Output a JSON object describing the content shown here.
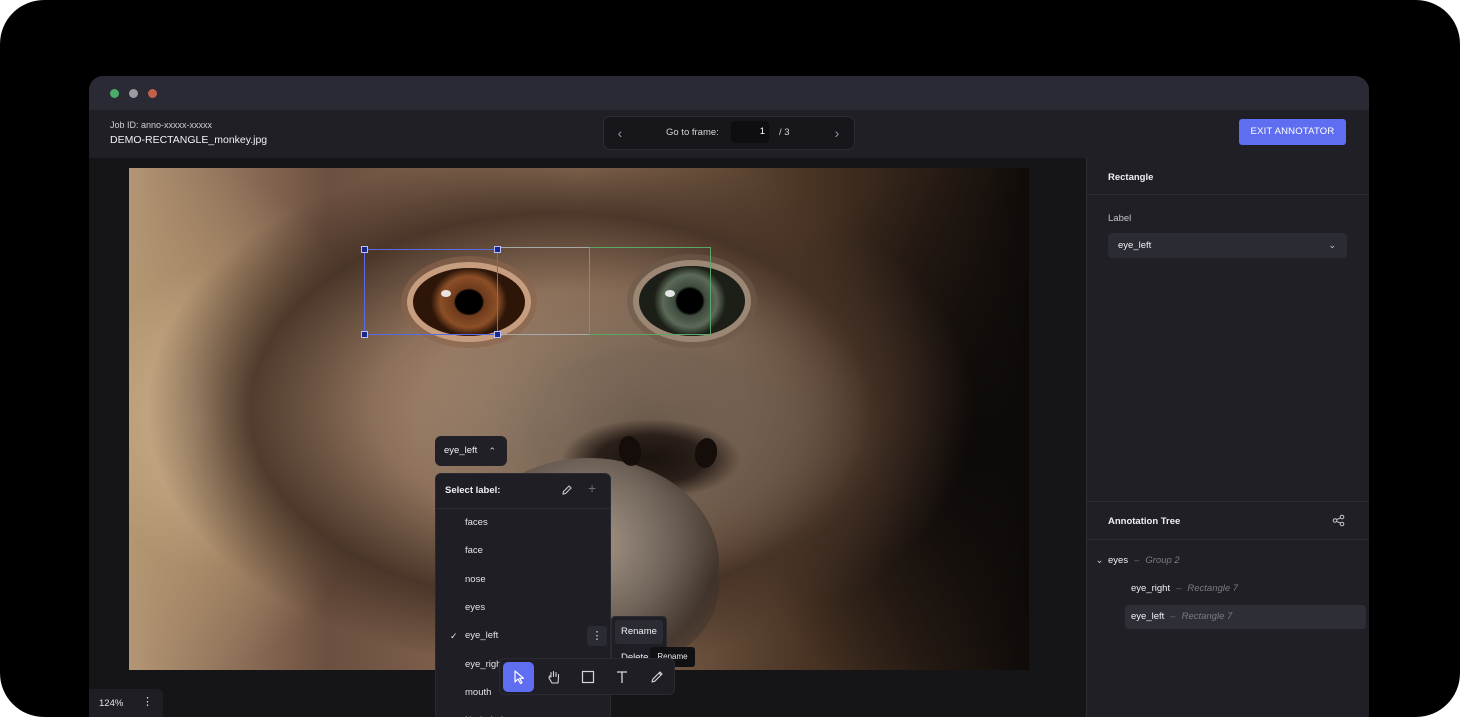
{
  "window": {
    "traffic_lights": [
      {
        "name": "close",
        "color": "#4caa6a"
      },
      {
        "name": "minimize",
        "color": "#9a9aa0"
      },
      {
        "name": "maximize",
        "color": "#c0624a"
      }
    ]
  },
  "header": {
    "job_id": "Job ID: anno-xxxxx-xxxxx",
    "file_name": "DEMO-RECTANGLE_monkey.jpg",
    "frame_nav": {
      "prev_icon": "chevron-left-icon",
      "label": "Go to frame:",
      "current": "1",
      "total": "/ 3",
      "next_icon": "chevron-right-icon"
    },
    "exit_label": "EXIT ANNOTATOR"
  },
  "canvas": {
    "selected_label": "eye_left",
    "dropdown": {
      "title": "Select label:",
      "items": [
        "faces",
        "face",
        "nose",
        "eyes",
        "eye_left",
        "eye_right",
        "mouth",
        "No Label"
      ],
      "checked": "eye_left",
      "check_mark": "✓",
      "more_icon": "⋮"
    },
    "context_menu": [
      "Rename",
      "Delete"
    ],
    "tooltip": "Rename",
    "tools": [
      "select-pointer",
      "pan-hand",
      "rectangle",
      "text",
      "pen"
    ],
    "active_tool": "select-pointer",
    "zoom": "124%",
    "zoom_menu_icon": "⋮"
  },
  "panel": {
    "title": "Rectangle",
    "label_caption": "Label",
    "label_value": "eye_left",
    "tree_title": "Annotation Tree",
    "tree": [
      {
        "name": "eyes",
        "sep": "–",
        "kind": "Group 2",
        "expanded_icon": "chevron-down-icon"
      },
      {
        "name": "eye_right",
        "sep": "–",
        "kind": "Rectangle 7"
      },
      {
        "name": "eye_left",
        "sep": "–",
        "kind": "Rectangle 7",
        "selected": true
      }
    ]
  },
  "colors": {
    "accent": "#5f6ef0",
    "bbox_selected": "#5a6ae0",
    "bbox_green": "#59a665"
  }
}
